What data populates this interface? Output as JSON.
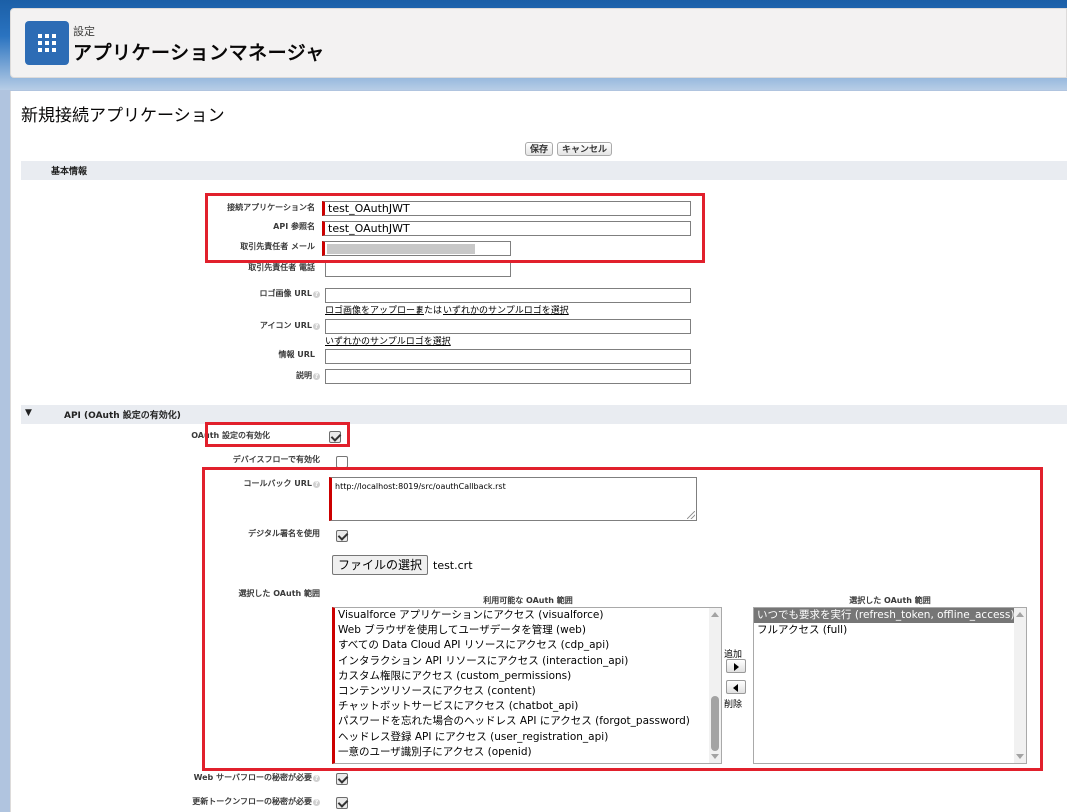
{
  "header": {
    "breadcrumb": "設定",
    "title": "アプリケーションマネージャ",
    "icon": "app-launcher-grid-icon"
  },
  "page": {
    "title": "新規接続アプリケーション",
    "save_label": "保存",
    "cancel_label": "キャンセル"
  },
  "basic_info": {
    "section_label": "基本情報",
    "app_name_label": "接続アプリケーション名",
    "app_name_value": "test_OAuthJWT",
    "api_name_label": "API 参照名",
    "api_name_value": "test_OAuthJWT",
    "contact_email_label": "取引先責任者 メール",
    "contact_phone_label": "取引先責任者 電話",
    "logo_url_label": "ロゴ画像 URL",
    "logo_upload_link": "ロゴ画像をアップロード",
    "logo_or_text": "または",
    "logo_sample_link": "いずれかのサンプルロゴを選択",
    "icon_url_label": "アイコン URL",
    "icon_sample_link": "いずれかのサンプルロゴを選択",
    "info_url_label": "情報 URL",
    "description_label": "説明"
  },
  "api": {
    "section_label": "API (OAuth 設定の有効化)",
    "enable_oauth_label": "OAuth 設定の有効化",
    "enable_oauth_checked": true,
    "device_flow_label": "デバイスフローで有効化",
    "device_flow_checked": false,
    "callback_url_label": "コールバック URL",
    "callback_url_value": "http://localhost:8019/src/oauthCallback.rst",
    "digital_sig_label": "デジタル署名を使用",
    "digital_sig_checked": true,
    "file_button_label": "ファイルの選択",
    "file_name": "test.crt",
    "scopes_label": "選択した OAuth 範囲",
    "available_header": "利用可能な OAuth 範囲",
    "selected_header": "選択した OAuth 範囲",
    "available_scopes": [
      "Visualforce アプリケーションにアクセス (visualforce)",
      "Web ブラウザを使用してユーザデータを管理 (web)",
      "すべての Data Cloud API リソースにアクセス (cdp_api)",
      "インタラクション API リソースにアクセス (interaction_api)",
      "カスタム権限にアクセス (custom_permissions)",
      "コンテンツリソースにアクセス (content)",
      "チャットボットサービスにアクセス (chatbot_api)",
      "パスワードを忘れた場合のヘッドレス API にアクセス (forgot_password)",
      "ヘッドレス登録 API にアクセス (user_registration_api)",
      "一意のユーザ識別子にアクセス (openid)"
    ],
    "selected_scopes": [
      "いつでも要求を実行 (refresh_token, offline_access)",
      "フルアクセス (full)"
    ],
    "add_label": "追加",
    "remove_label": "削除",
    "web_secret_label": "Web サーバフローの秘密が必要",
    "web_secret_checked": true,
    "refresh_secret_label": "更新トークンフローの秘密が必要",
    "refresh_secret_checked": true
  },
  "colors": {
    "highlight": "#e1202c",
    "brand": "#2d6cb5"
  }
}
